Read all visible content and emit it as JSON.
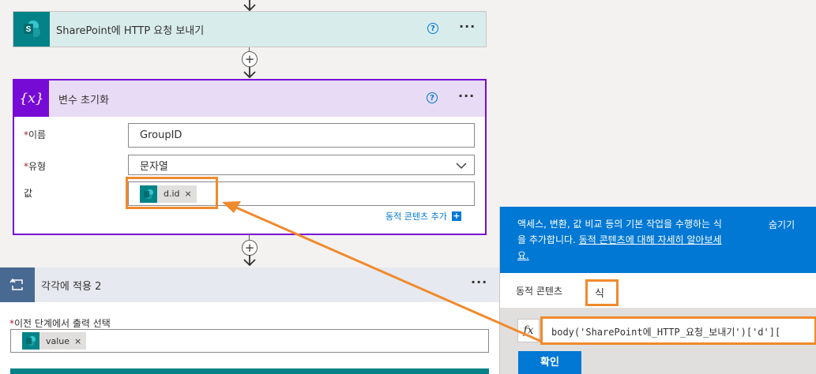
{
  "http_action": {
    "title": "SharePoint에 HTTP 요청 보내기",
    "help": "?",
    "more": "···"
  },
  "init_var": {
    "title": "변수 초기화",
    "icon_text": "{x}",
    "help": "?",
    "more": "···",
    "name": {
      "required": "*",
      "label": "이름",
      "value": "GroupID"
    },
    "type": {
      "required": "*",
      "label": "유형",
      "value": "문자열"
    },
    "value": {
      "label": "값",
      "token": "d.id",
      "token_remove": "×"
    },
    "add_dynamic": "동적 콘텐츠 추가",
    "add_dynamic_plus": "+"
  },
  "foreach": {
    "title": "각각에 적용 2",
    "more": "···",
    "select": {
      "required": "*",
      "label": "이전 단계에서 출력 선택",
      "token": "value",
      "token_remove": "×"
    }
  },
  "panel": {
    "info_text_1": "액세스, 변환, 값 비교 등의 기본 작업을 수행하는 식",
    "info_text_2": "을 추가합니다. ",
    "info_link_1": "동적 콘텐츠에 대해 자세히 알아보세",
    "info_link_2": "요.",
    "hide": "숨기기",
    "tabs": [
      "동적 콘텐츠",
      "식"
    ],
    "fx": "fx",
    "expression": "body('SharePoint에_HTTP_요청_보내기')['d'][",
    "confirm": "확인"
  },
  "colors": {
    "sp_teal": "#038387",
    "var_purple": "#770bd6",
    "var_header": "#e8dbf5",
    "foreach_tile": "#486991",
    "accent_blue": "#0078d4",
    "highlight_orange": "#f08a2c"
  }
}
